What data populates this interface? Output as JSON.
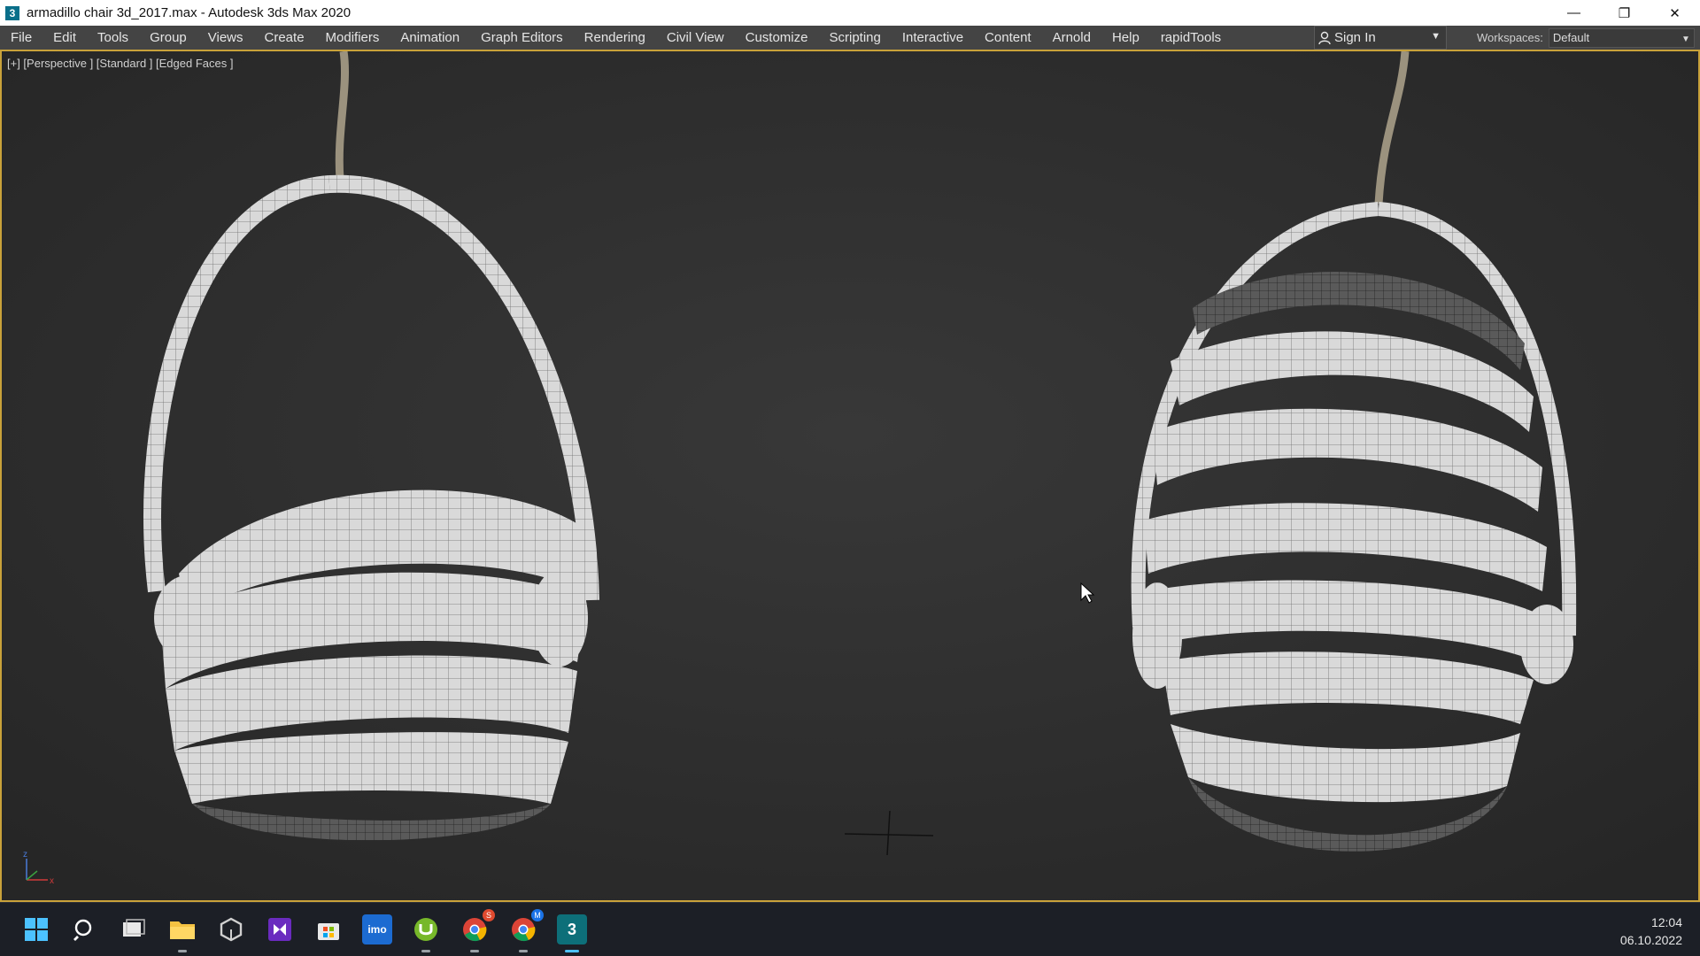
{
  "window": {
    "app_icon_glyph": "3",
    "title": "armadillo chair 3d_2017.max - Autodesk 3ds Max 2020",
    "controls": {
      "minimize": "—",
      "restore": "❐",
      "close": "✕"
    }
  },
  "menu": [
    "File",
    "Edit",
    "Tools",
    "Group",
    "Views",
    "Create",
    "Modifiers",
    "Animation",
    "Graph Editors",
    "Rendering",
    "Civil View",
    "Customize",
    "Scripting",
    "Interactive",
    "Content",
    "Arnold",
    "Help",
    "rapidTools"
  ],
  "signin": {
    "label": "Sign In",
    "icon": "user-icon"
  },
  "workspaces": {
    "label": "Workspaces:",
    "value": "Default"
  },
  "viewport": {
    "label": "[+] [Perspective ] [Standard ] [Edged Faces ]",
    "border_color": "#c9a23a",
    "axis": {
      "z": "z",
      "x": "x"
    }
  },
  "taskbar": {
    "icons": [
      "windows-start-icon",
      "search-icon",
      "task-view-icon",
      "file-explorer-icon",
      "unity-icon",
      "visual-studio-icon",
      "microsoft-store-icon",
      "imo-icon",
      "utorrent-icon",
      "chrome-icon",
      "chrome-profile-icon",
      "3dsmax-icon"
    ],
    "chrome_badge_1": "S",
    "chrome_badge_2": "M",
    "imo_label": "imo",
    "time": "12:04",
    "date": "06.10.2022"
  }
}
